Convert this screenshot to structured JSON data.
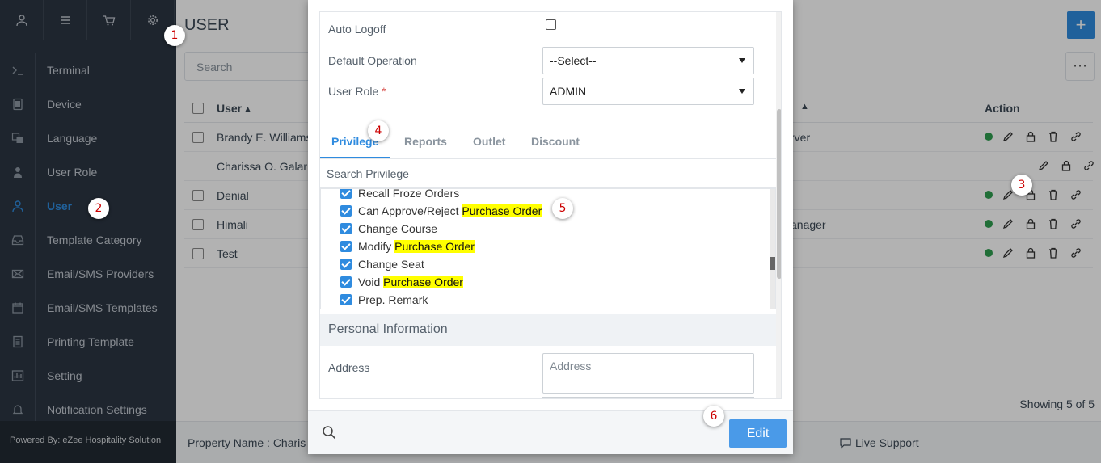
{
  "sidebar": {
    "top_icons": [
      "user-icon",
      "menu-icon",
      "cart-icon",
      "gear-icon"
    ],
    "items": [
      {
        "label": "Terminal",
        "icon": "terminal-icon"
      },
      {
        "label": "Device",
        "icon": "device-icon"
      },
      {
        "label": "Language",
        "icon": "language-icon"
      },
      {
        "label": "User Role",
        "icon": "user-role-icon"
      },
      {
        "label": "User",
        "icon": "user-icon",
        "active": true
      },
      {
        "label": "Template Category",
        "icon": "inbox-icon"
      },
      {
        "label": "Email/SMS Providers",
        "icon": "envelope-icon"
      },
      {
        "label": "Email/SMS Templates",
        "icon": "calendar-icon"
      },
      {
        "label": "Printing Template",
        "icon": "document-icon"
      },
      {
        "label": "Setting",
        "icon": "chart-icon"
      },
      {
        "label": "Notification Settings",
        "icon": "bell-icon"
      }
    ],
    "powered_by": "Powered By: eZee Hospitality Solution"
  },
  "main": {
    "title": "USER",
    "search_placeholder": "Search",
    "table": {
      "col_user": "User ▴",
      "col_action": "Action",
      "rows": [
        {
          "name": "Brandy E. Williams",
          "role": "rver",
          "status": "active",
          "has_check": true
        },
        {
          "name": "Charissa O. Galar",
          "role": "",
          "status": "",
          "has_check": false
        },
        {
          "name": "Denial",
          "role": "",
          "status": "active",
          "has_check": true
        },
        {
          "name": "Himali",
          "role": "anager",
          "status": "active",
          "has_check": true
        },
        {
          "name": "Test",
          "role": "",
          "status": "active",
          "has_check": true
        }
      ]
    },
    "showing": "Showing 5 of 5",
    "footer": {
      "property": "Property Name : Charis",
      "live_support": "Live Support"
    }
  },
  "modal": {
    "auto_logoff_label": "Auto Logoff",
    "default_operation_label": "Default Operation",
    "default_operation_value": "--Select--",
    "user_role_label": "User Role",
    "user_role_required": "*",
    "user_role_value": "ADMIN",
    "tabs": [
      "Privilege",
      "Reports",
      "Outlet",
      "Discount"
    ],
    "privilege_search": "Search Privilege",
    "privileges": [
      {
        "text": "Recall Froze Orders",
        "highlight": ""
      },
      {
        "text": "Can Approve/Reject ",
        "highlight": "Purchase Order"
      },
      {
        "text": "Change Course",
        "highlight": ""
      },
      {
        "text": "Modify ",
        "highlight": "Purchase Order"
      },
      {
        "text": "Change Seat",
        "highlight": ""
      },
      {
        "text": "Void ",
        "highlight": "Purchase Order"
      },
      {
        "text": "Prep. Remark",
        "highlight": ""
      }
    ],
    "personal_info_heading": "Personal Information",
    "address_label": "Address",
    "address_placeholder": "Address",
    "edit_button": "Edit"
  },
  "callouts": [
    "1",
    "2",
    "3",
    "4",
    "5",
    "6"
  ],
  "colors": {
    "accent": "#2f8bdf",
    "sidebar_bg": "#2c3642",
    "highlight": "#ffff00",
    "status_active": "#2e9e4f",
    "callout_text": "#cc0000"
  }
}
